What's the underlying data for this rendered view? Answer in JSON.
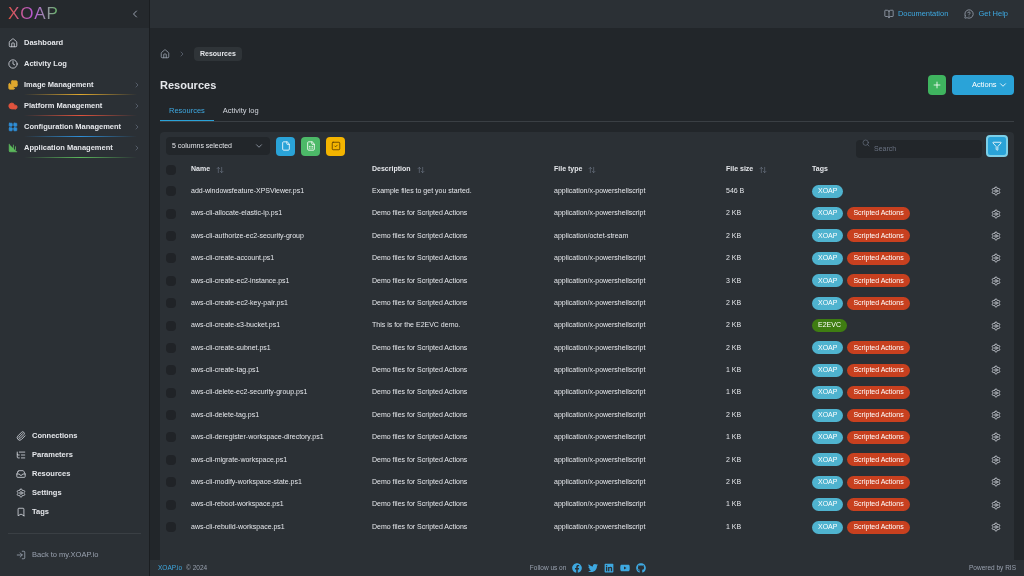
{
  "sidebar": {
    "logo": "XOAP",
    "nav": [
      {
        "label": "Dashboard",
        "expandable": false
      },
      {
        "label": "Activity Log",
        "expandable": false
      },
      {
        "label": "Image Management",
        "expandable": true,
        "color": "#e0a82e"
      },
      {
        "label": "Platform Management",
        "expandable": true,
        "color": "#e0533d"
      },
      {
        "label": "Configuration Management",
        "expandable": true,
        "color": "#2f8fd8"
      },
      {
        "label": "Application Management",
        "expandable": true,
        "color": "#5cb85c"
      }
    ],
    "bottom_nav": [
      "Connections",
      "Parameters",
      "Resources",
      "Settings",
      "Tags"
    ],
    "back_link": "Back to my.XOAP.io"
  },
  "header": {
    "links": [
      "Documentation",
      "Get Help"
    ]
  },
  "breadcrumb": [
    "Resources"
  ],
  "page_title": "Resources",
  "actions_button": "Actions",
  "tabs": [
    {
      "label": "Resources",
      "selected": true
    },
    {
      "label": "Activity log",
      "selected": false
    }
  ],
  "toolbar": {
    "columns_select": "5 columns selected",
    "search_placeholder": "Search"
  },
  "table": {
    "columns": [
      {
        "label": "Name",
        "sortable": true
      },
      {
        "label": "Description",
        "sortable": true
      },
      {
        "label": "File type",
        "sortable": true
      },
      {
        "label": "File size",
        "sortable": true
      },
      {
        "label": "Tags",
        "sortable": false
      }
    ],
    "select_all_checked": false,
    "rows": [
      {
        "checked": false,
        "name": "add-windowsfeature-XPSViewer.ps1",
        "description": "Example files to get you started.",
        "file_type": "application/x-powershellscript",
        "file_size": "546 B",
        "tags": [
          {
            "label": "XOAP",
            "color": "#4fb3cf"
          }
        ]
      },
      {
        "checked": false,
        "name": "aws-cli-allocate-elastic-ip.ps1",
        "description": "Demo files for Scripted Actions",
        "file_type": "application/x-powershellscript",
        "file_size": "2 KB",
        "tags": [
          {
            "label": "XOAP",
            "color": "#4fb3cf"
          },
          {
            "label": "Scripted Actions",
            "color": "#c8401f"
          }
        ]
      },
      {
        "checked": false,
        "name": "aws-cli-authorize-ec2-security-group",
        "description": "Demo files for Scripted Actions",
        "file_type": "application/octet-stream",
        "file_size": "2 KB",
        "tags": [
          {
            "label": "XOAP",
            "color": "#4fb3cf"
          },
          {
            "label": "Scripted Actions",
            "color": "#c8401f"
          }
        ]
      },
      {
        "checked": false,
        "name": "aws-cli-create-account.ps1",
        "description": "Demo files for Scripted Actions",
        "file_type": "application/x-powershellscript",
        "file_size": "2 KB",
        "tags": [
          {
            "label": "XOAP",
            "color": "#4fb3cf"
          },
          {
            "label": "Scripted Actions",
            "color": "#c8401f"
          }
        ]
      },
      {
        "checked": false,
        "name": "aws-cli-create-ec2-instance.ps1",
        "description": "Demo files for Scripted Actions",
        "file_type": "application/x-powershellscript",
        "file_size": "3 KB",
        "tags": [
          {
            "label": "XOAP",
            "color": "#4fb3cf"
          },
          {
            "label": "Scripted Actions",
            "color": "#c8401f"
          }
        ]
      },
      {
        "checked": false,
        "name": "aws-cli-create-ec2-key-pair.ps1",
        "description": "Demo files for Scripted Actions",
        "file_type": "application/x-powershellscript",
        "file_size": "2 KB",
        "tags": [
          {
            "label": "XOAP",
            "color": "#4fb3cf"
          },
          {
            "label": "Scripted Actions",
            "color": "#c8401f"
          }
        ]
      },
      {
        "checked": false,
        "name": "aws-cli-create-s3-bucket.ps1",
        "description": "This is for the E2EVC demo.",
        "file_type": "application/x-powershellscript",
        "file_size": "2 KB",
        "tags": [
          {
            "label": "E2EVC",
            "color": "#3f7d12"
          }
        ]
      },
      {
        "checked": false,
        "name": "aws-cli-create-subnet.ps1",
        "description": "Demo files for Scripted Actions",
        "file_type": "application/x-powershellscript",
        "file_size": "2 KB",
        "tags": [
          {
            "label": "XOAP",
            "color": "#4fb3cf"
          },
          {
            "label": "Scripted Actions",
            "color": "#c8401f"
          }
        ]
      },
      {
        "checked": false,
        "name": "aws-cli-create-tag.ps1",
        "description": "Demo files for Scripted Actions",
        "file_type": "application/x-powershellscript",
        "file_size": "1 KB",
        "tags": [
          {
            "label": "XOAP",
            "color": "#4fb3cf"
          },
          {
            "label": "Scripted Actions",
            "color": "#c8401f"
          }
        ]
      },
      {
        "checked": false,
        "name": "aws-cli-delete-ec2-security-group.ps1",
        "description": "Demo files for Scripted Actions",
        "file_type": "application/x-powershellscript",
        "file_size": "1 KB",
        "tags": [
          {
            "label": "XOAP",
            "color": "#4fb3cf"
          },
          {
            "label": "Scripted Actions",
            "color": "#c8401f"
          }
        ]
      },
      {
        "checked": false,
        "name": "aws-cli-delete-tag.ps1",
        "description": "Demo files for Scripted Actions",
        "file_type": "application/x-powershellscript",
        "file_size": "2 KB",
        "tags": [
          {
            "label": "XOAP",
            "color": "#4fb3cf"
          },
          {
            "label": "Scripted Actions",
            "color": "#c8401f"
          }
        ]
      },
      {
        "checked": false,
        "name": "aws-cli-deregister-workspace-directory.ps1",
        "description": "Demo files for Scripted Actions",
        "file_type": "application/x-powershellscript",
        "file_size": "1 KB",
        "tags": [
          {
            "label": "XOAP",
            "color": "#4fb3cf"
          },
          {
            "label": "Scripted Actions",
            "color": "#c8401f"
          }
        ]
      },
      {
        "checked": false,
        "name": "aws-cli-migrate-workspace.ps1",
        "description": "Demo files for Scripted Actions",
        "file_type": "application/x-powershellscript",
        "file_size": "2 KB",
        "tags": [
          {
            "label": "XOAP",
            "color": "#4fb3cf"
          },
          {
            "label": "Scripted Actions",
            "color": "#c8401f"
          }
        ]
      },
      {
        "checked": false,
        "name": "aws-cli-modify-workspace-state.ps1",
        "description": "Demo files for Scripted Actions",
        "file_type": "application/x-powershellscript",
        "file_size": "2 KB",
        "tags": [
          {
            "label": "XOAP",
            "color": "#4fb3cf"
          },
          {
            "label": "Scripted Actions",
            "color": "#c8401f"
          }
        ]
      },
      {
        "checked": false,
        "name": "aws-cli-reboot-workspace.ps1",
        "description": "Demo files for Scripted Actions",
        "file_type": "application/x-powershellscript",
        "file_size": "1 KB",
        "tags": [
          {
            "label": "XOAP",
            "color": "#4fb3cf"
          },
          {
            "label": "Scripted Actions",
            "color": "#c8401f"
          }
        ]
      },
      {
        "checked": false,
        "name": "aws-cli-rebuild-workspace.ps1",
        "description": "Demo files for Scripted Actions",
        "file_type": "application/x-powershellscript",
        "file_size": "1 KB",
        "tags": [
          {
            "label": "XOAP",
            "color": "#4fb3cf"
          },
          {
            "label": "Scripted Actions",
            "color": "#c8401f"
          }
        ]
      }
    ]
  },
  "footer": {
    "brand_link": "XOAP.io",
    "copyright": "© 2024",
    "follow": "Follow us on",
    "powered": "Powered by RIS"
  }
}
